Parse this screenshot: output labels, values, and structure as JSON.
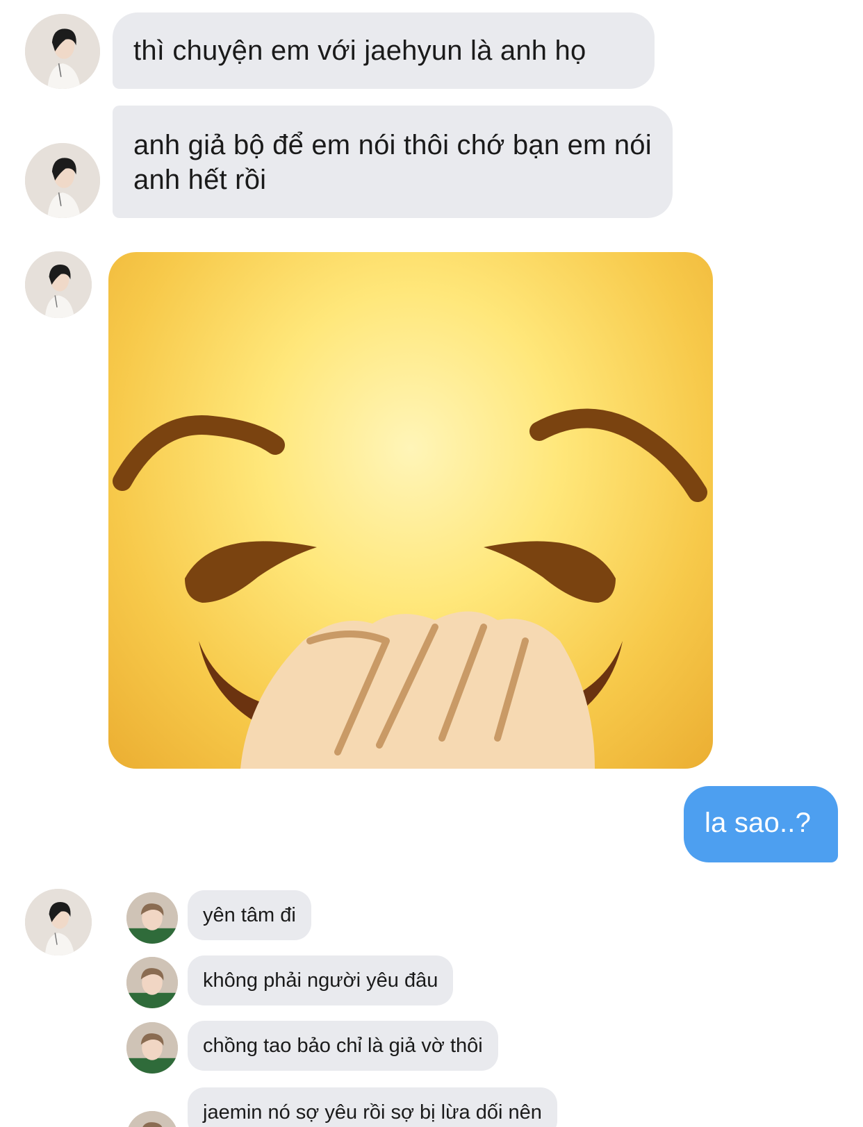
{
  "conversation": {
    "messages": [
      {
        "sender": "contact",
        "text": "thì chuyện em với jaehyun là anh họ"
      },
      {
        "sender": "contact",
        "text": "anh giả bộ để em nói thôi chớ bạn em nói anh hết rồi"
      },
      {
        "sender": "contact",
        "type": "image",
        "image_description": "hand-over-mouth-emoji-icon"
      },
      {
        "sender": "me",
        "text": "la sao..?"
      }
    ],
    "forwarded": {
      "messages": [
        {
          "text": "yên tâm đi"
        },
        {
          "text": "không phải người yêu đâu"
        },
        {
          "text": "chồng tao bảo chỉ là giả vờ thôi"
        },
        {
          "text": "jaemin nó sợ yêu rồi sợ bị lừa dối nên"
        }
      ]
    }
  },
  "colors": {
    "incoming_bubble": "#e9eaee",
    "outgoing_bubble": "#4d9ff0",
    "background": "#ffffff"
  }
}
